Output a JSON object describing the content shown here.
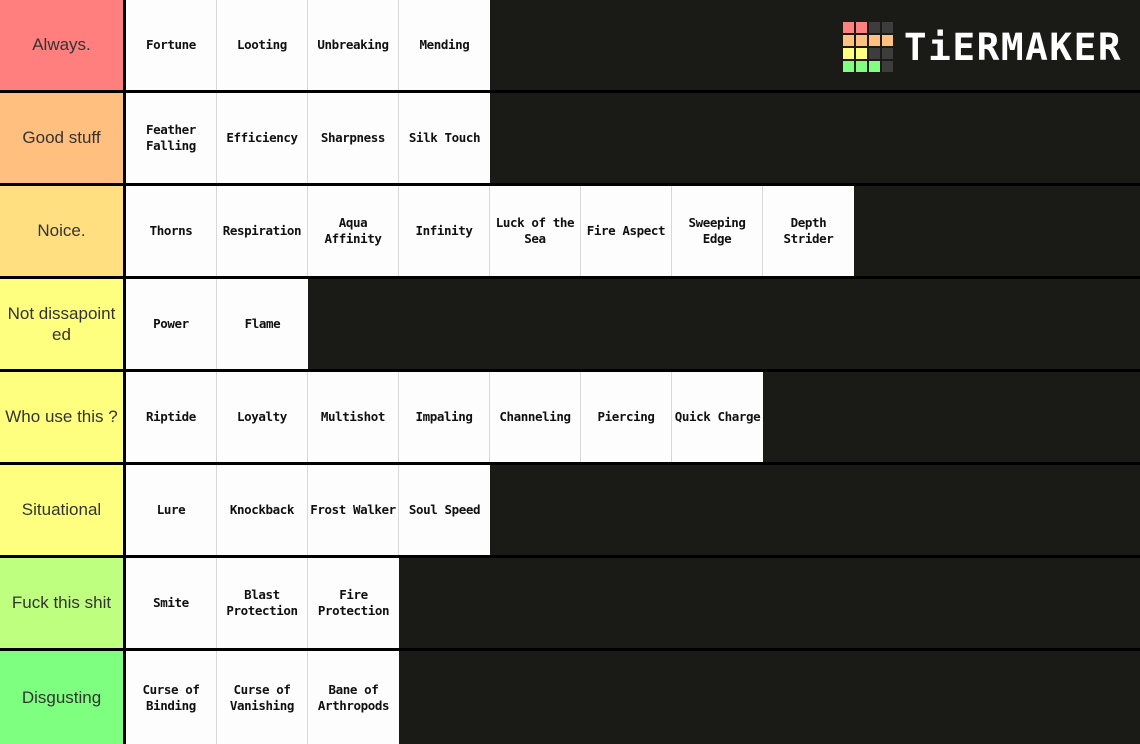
{
  "app": {
    "name": "TierMaker",
    "logo_text": "TiERMAKER",
    "background_color": "#1a1a16"
  },
  "logo_grid": {
    "colors": [
      [
        "#ff8080",
        "#ff8080",
        "#3d3d3d",
        "#3d3d3d"
      ],
      [
        "#ffc080",
        "#ffc080",
        "#ffc080",
        "#ffc080"
      ],
      [
        "#ffff80",
        "#ffff80",
        "#3d3d3d",
        "#3d3d3d"
      ],
      [
        "#80ff80",
        "#80ff80",
        "#80ff80",
        "#3d3d3d"
      ]
    ]
  },
  "tiers": [
    {
      "label": "Always.",
      "color": "#ff7f7f",
      "items": [
        "Fortune",
        "Looting",
        "Unbreaking",
        "Mending"
      ]
    },
    {
      "label": "Good stuff",
      "color": "#ffbf7f",
      "items": [
        "Feather Falling",
        "Efficiency",
        "Sharpness",
        "Silk Touch"
      ]
    },
    {
      "label": "Noice.",
      "color": "#ffdf80",
      "items": [
        "Thorns",
        "Respiration",
        "Aqua Affinity",
        "Infinity",
        "Luck of the Sea",
        "Fire Aspect",
        "Sweeping Edge",
        "Depth Strider"
      ]
    },
    {
      "label": "Not dissapointed",
      "color": "#ffff7f",
      "items": [
        "Power",
        "Flame"
      ]
    },
    {
      "label": "Who use this ?",
      "color": "#ffff7f",
      "items": [
        "Riptide",
        "Loyalty",
        "Multishot",
        "Impaling",
        "Channeling",
        "Piercing",
        "Quick Charge"
      ]
    },
    {
      "label": "Situational",
      "color": "#ffff7f",
      "items": [
        "Lure",
        "Knockback",
        "Frost Walker",
        "Soul Speed"
      ]
    },
    {
      "label": "Fuck this shit",
      "color": "#bfff7f",
      "items": [
        "Smite",
        "Blast Protection",
        "Fire Protection"
      ]
    },
    {
      "label": "Disgusting",
      "color": "#7fff7f",
      "items": [
        "Curse of Binding",
        "Curse of Vanishing",
        "Bane of Arthropods"
      ]
    }
  ]
}
